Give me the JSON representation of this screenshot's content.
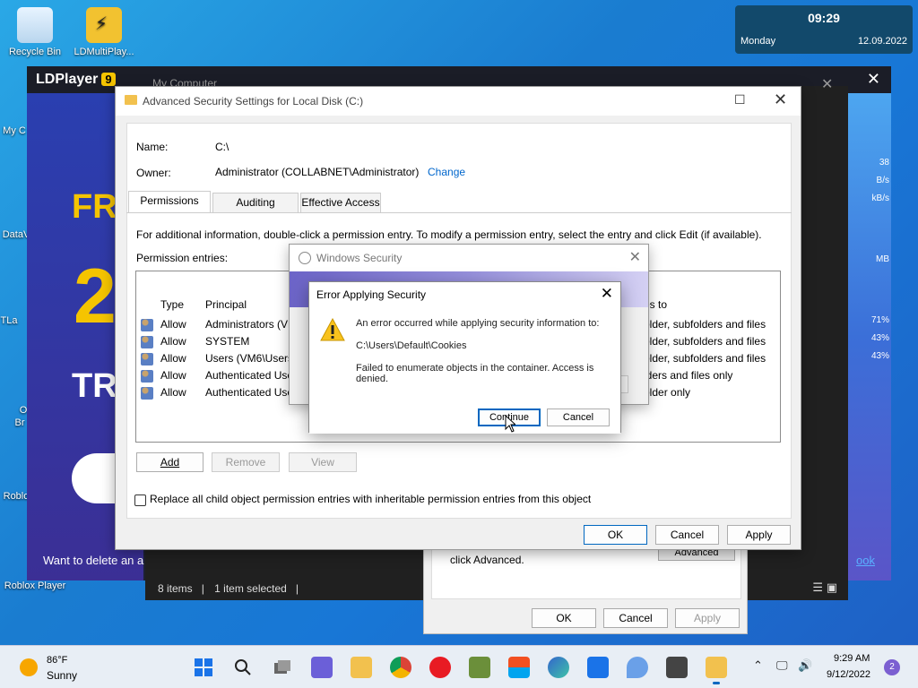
{
  "desktop": {
    "icons": [
      {
        "label": "Recycle Bin"
      },
      {
        "label": "LDMultiPlay..."
      },
      {
        "label": "My C"
      },
      {
        "label": "DataV"
      },
      {
        "label": "TLa"
      },
      {
        "label": "O"
      },
      {
        "label": "Br"
      },
      {
        "label": "Roblo"
      },
      {
        "label": "Roblox Player"
      }
    ]
  },
  "widget": {
    "time": "09:29",
    "day": "Monday",
    "date": "12.09.2022"
  },
  "ldplayer": {
    "brand": "LDPlayer",
    "version_badge": "9",
    "game_text": {
      "line1": "FR",
      "line2": "2",
      "line3": "TR"
    },
    "stats": [
      "38",
      "B/s",
      "kB/s",
      "MB",
      "71%",
      "43%",
      "43%"
    ],
    "bottom_text": "Want to delete an a",
    "bottom_link": "ook"
  },
  "explorer": {
    "title": "My Computer",
    "status": {
      "items": "8 items",
      "selected": "1 item selected"
    }
  },
  "properties": {
    "hint_text": "click Advanced.",
    "advanced_label": "Advanced",
    "ok": "OK",
    "cancel": "Cancel",
    "apply": "Apply"
  },
  "advanced": {
    "title": "Advanced Security Settings for Local Disk (C:)",
    "name_label": "Name:",
    "name_value": "C:\\",
    "owner_label": "Owner:",
    "owner_value": "Administrator (COLLABNET\\Administrator)",
    "change_link": "Change",
    "tabs": [
      "Permissions",
      "Auditing",
      "Effective Access"
    ],
    "info_text": "For additional information, double-click a permission entry. To modify a permission entry, select the entry and click Edit (if available).",
    "entries_label": "Permission entries:",
    "columns": {
      "type": "Type",
      "principal": "Principal",
      "applies": "es to"
    },
    "rows": [
      {
        "type": "Allow",
        "principal": "Administrators (VM",
        "applies": "older, subfolders and files"
      },
      {
        "type": "Allow",
        "principal": "SYSTEM",
        "applies": "older, subfolders and files"
      },
      {
        "type": "Allow",
        "principal": "Users (VM6\\Users)",
        "applies": "older, subfolders and files"
      },
      {
        "type": "Allow",
        "principal": "Authenticated Use",
        "applies": "lders and files only"
      },
      {
        "type": "Allow",
        "principal": "Authenticated Use",
        "applies": "older only"
      }
    ],
    "add": "Add",
    "remove": "Remove",
    "view": "View",
    "replace_label": "Replace all child object permission entries with inheritable permission entries from this object",
    "ok": "OK",
    "cancel": "Cancel",
    "apply": "Apply"
  },
  "winsec": {
    "title": "Windows Security"
  },
  "error": {
    "title": "Error Applying Security",
    "line1": "An error occurred while applying security information to:",
    "path": "C:\\Users\\Default\\Cookies",
    "line3": "Failed to enumerate objects in the container. Access is denied.",
    "continue": "Continue",
    "cancel": "Cancel"
  },
  "taskbar": {
    "weather_temp": "86°F",
    "weather_desc": "Sunny",
    "time": "9:29 AM",
    "date": "9/12/2022",
    "notifications": "2",
    "apps": [
      "start-icon",
      "search-icon",
      "task-view-icon",
      "chat-icon",
      "file-explorer-icon",
      "chrome-icon",
      "opera-icon",
      "minecraft-icon",
      "store-icon",
      "edge-icon",
      "mail-icon",
      "drop-icon",
      "settings-icon",
      "folder-icon"
    ]
  }
}
